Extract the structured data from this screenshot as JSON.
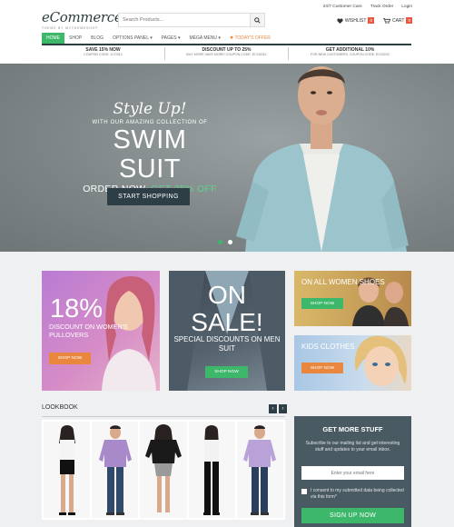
{
  "header": {
    "logo_text": "eCommerce",
    "logo_tagline": "THEME BY MYTHEMESHOP",
    "search": {
      "placeholder": "Search Products..."
    },
    "top_links": [
      "24/7 Customer Care",
      "Track Order",
      "Login"
    ],
    "wishlist": {
      "label": "WISHLIST",
      "count": "0"
    },
    "cart": {
      "label": "CART",
      "count": "0"
    }
  },
  "nav": {
    "items": [
      "HOME",
      "SHOP",
      "BLOG",
      "OPTIONS PANEL ▾",
      "PAGES ▾",
      "MEGA MENU ▾",
      "TODAY'S OFFER"
    ],
    "active": "HOME"
  },
  "promos": [
    {
      "title": "SAVE 15% NOW",
      "sub": "COUPON CODE: 1CO312"
    },
    {
      "title": "DISCOUNT UP TO 25%",
      "sub": "BUY MORE SAVE MORE! COUPON CODE: ECO3242"
    },
    {
      "title": "GET ADDITIONAL 10%",
      "sub": "FOR NEW CUSTOMERS. COUPON CODE: EC03242"
    }
  ],
  "hero": {
    "style_up": "Style Up!",
    "with_text": "WITH OUR AMAZING COLLECTION OF",
    "headline": "SWIM SUIT",
    "order_text": "ORDER NOW,",
    "offer_text": "GET 35% OFF",
    "button": "START SHOPPING"
  },
  "banners": {
    "pullovers": {
      "percent": "18%",
      "text": "DISCOUNT ON WOMEN'S PULLOVERS",
      "button": "SHOP NOW"
    },
    "sale": {
      "headline": "ON SALE!",
      "sub": "SPECIAL DISCOUNTS ON MEN SUIT",
      "button": "SHOP NOW"
    },
    "women_shoes": {
      "label": "ON ALL WOMEN SHOES",
      "button": "SHOP NOW"
    },
    "kids": {
      "label": "KIDS CLOTHES",
      "button": "SHOP NOW"
    }
  },
  "lookbook": {
    "title": "LOOKBOOK",
    "prev": "‹",
    "next": "›"
  },
  "newsletter": {
    "title": "GET MORE STUFF",
    "text": "Subscribe to our mailing list and get interesting stuff and updates to your email inbox.",
    "placeholder": "Enter your email here",
    "consent": "I consent to my submitted data being collected via this form*",
    "button": "SIGN UP NOW"
  },
  "colors": {
    "accent": "#3db86b",
    "dark": "#2d3e47",
    "orange": "#e9873f",
    "badge": "#e9573f"
  }
}
